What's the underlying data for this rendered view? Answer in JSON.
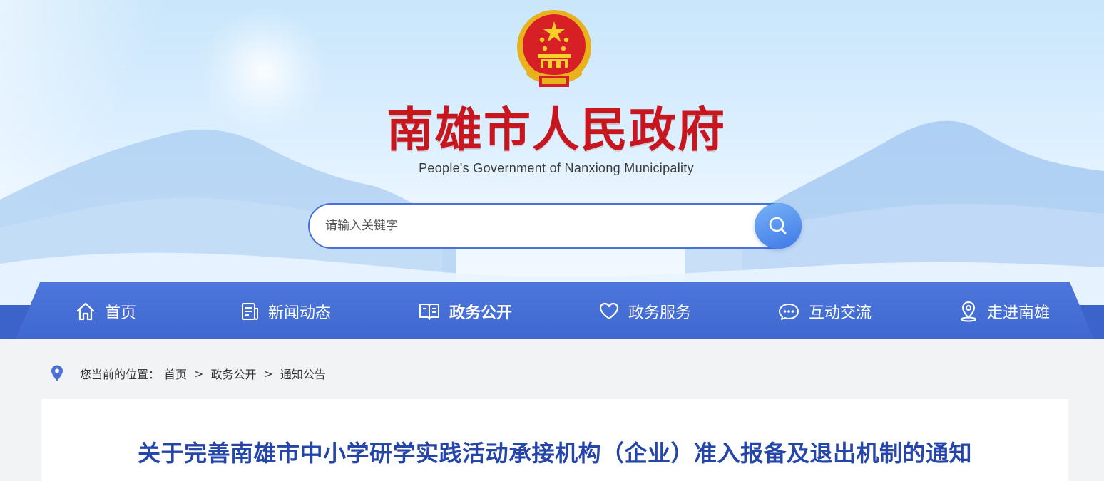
{
  "header": {
    "title_cn": "南雄市人民政府",
    "title_en": "People's Government of Nanxiong Municipality",
    "emblem_icon": "national-emblem-icon"
  },
  "search": {
    "placeholder": "请输入关键字",
    "button_icon": "search-icon"
  },
  "nav": {
    "items": [
      {
        "label": "首页",
        "icon": "home-icon"
      },
      {
        "label": "新闻动态",
        "icon": "news-icon"
      },
      {
        "label": "政务公开",
        "icon": "book-icon",
        "active": true
      },
      {
        "label": "政务服务",
        "icon": "heart-icon"
      },
      {
        "label": "互动交流",
        "icon": "chat-icon"
      },
      {
        "label": "走进南雄",
        "icon": "location-icon"
      }
    ]
  },
  "breadcrumb": {
    "prefix": "您当前的位置：",
    "items": [
      "首页",
      "政务公开",
      "通知公告"
    ],
    "separator": ">"
  },
  "article": {
    "title": "关于完善南雄市中小学研学实践活动承接机构（企业）准入报备及退出机制的通知"
  },
  "colors": {
    "brand_blue": "#3f68d0",
    "title_red": "#c8161e",
    "article_title_blue": "#2546a8"
  }
}
